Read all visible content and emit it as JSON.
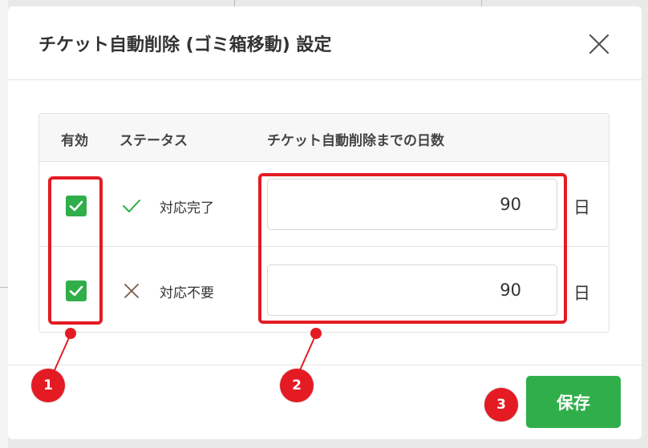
{
  "dialog": {
    "title": "チケット自動削除 (ゴミ箱移動) 設定",
    "close_icon": "close-icon"
  },
  "table": {
    "headers": {
      "enabled": "有効",
      "status": "ステータス",
      "days_until_delete": "チケット自動削除までの日数"
    },
    "rows": [
      {
        "enabled": true,
        "status_icon": "check-icon",
        "status_color": "#2fae4a",
        "status_label": "対応完了",
        "days": "90",
        "unit": "日"
      },
      {
        "enabled": true,
        "status_icon": "cross-icon",
        "status_color": "#7a5a48",
        "status_label": "対応不要",
        "days": "90",
        "unit": "日"
      }
    ]
  },
  "footer": {
    "save_label": "保存"
  },
  "annotations": {
    "badges": [
      "1",
      "2",
      "3"
    ],
    "highlight_color": "#e41b23"
  },
  "colors": {
    "accent": "#2fae4a",
    "annotation": "#e41b23"
  }
}
